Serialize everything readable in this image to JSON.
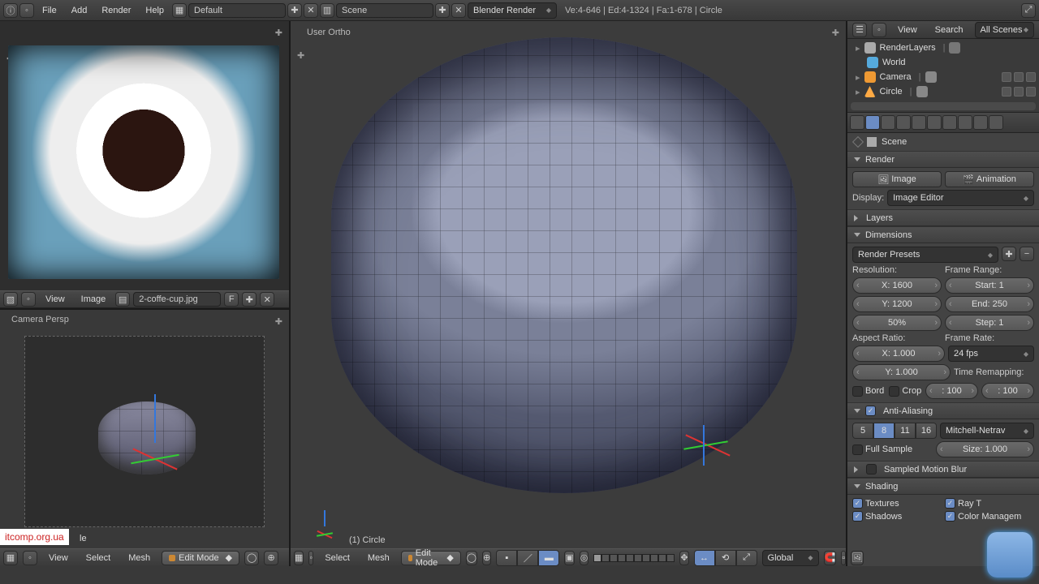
{
  "top": {
    "menus": [
      "File",
      "Add",
      "Render",
      "Help"
    ],
    "layout_field": "Default",
    "scene_field": "Scene",
    "engine": "Blender Render",
    "stats": "Ve:4-646 | Ed:4-1324 | Fa:1-678 | Circle"
  },
  "ref": {
    "menus": [
      "View",
      "Image"
    ],
    "filename": "2-coffe-cup.jpg",
    "flag": "F"
  },
  "camview": {
    "label": "Camera Persp",
    "obj": "le",
    "watermark": "itcomp.org.ua",
    "bar": {
      "menus": [
        "View",
        "Select",
        "Mesh"
      ],
      "mode": "Edit Mode"
    }
  },
  "viewport": {
    "label": "User Ortho",
    "obj": "(1) Circle",
    "bar": {
      "menus": [
        "Select",
        "Mesh"
      ],
      "mode": "Edit Mode",
      "orient": "Global"
    }
  },
  "outliner": {
    "hdr": {
      "view": "View",
      "search": "Search",
      "filter": "All Scenes"
    },
    "rows": [
      {
        "name": "RenderLayers",
        "ico": "scene"
      },
      {
        "name": "World",
        "ico": "world"
      },
      {
        "name": "Camera",
        "ico": "cam"
      },
      {
        "name": "Circle",
        "ico": "mesh"
      }
    ]
  },
  "props": {
    "crumb": "Scene",
    "render": {
      "title": "Render",
      "image": "Image",
      "anim": "Animation",
      "display_lbl": "Display:",
      "display": "Image Editor"
    },
    "layers": {
      "title": "Layers"
    },
    "dims": {
      "title": "Dimensions",
      "presets": "Render Presets",
      "res_lbl": "Resolution:",
      "frame_lbl": "Frame Range:",
      "x": "X: 1600",
      "y": "Y: 1200",
      "pct": "50%",
      "start": "Start: 1",
      "end": "End: 250",
      "step": "Step: 1",
      "aspect_lbl": "Aspect Ratio:",
      "rate_lbl": "Frame Rate:",
      "ax": "X: 1.000",
      "ay": "Y: 1.000",
      "fps": "24 fps",
      "remap_lbl": "Time Remapping:",
      "o": ": 100",
      "n": ": 100",
      "bord": "Bord",
      "crop": "Crop"
    },
    "aa": {
      "title": "Anti-Aliasing",
      "s5": "5",
      "s8": "8",
      "s11": "11",
      "s16": "16",
      "filter": "Mitchell-Netrav",
      "full": "Full Sample",
      "size": "Size: 1.000"
    },
    "smb": {
      "title": "Sampled Motion Blur"
    },
    "shading": {
      "title": "Shading",
      "tex": "Textures",
      "shad": "Shadows",
      "ray": "Ray T",
      "cm": "Color Managem"
    }
  }
}
